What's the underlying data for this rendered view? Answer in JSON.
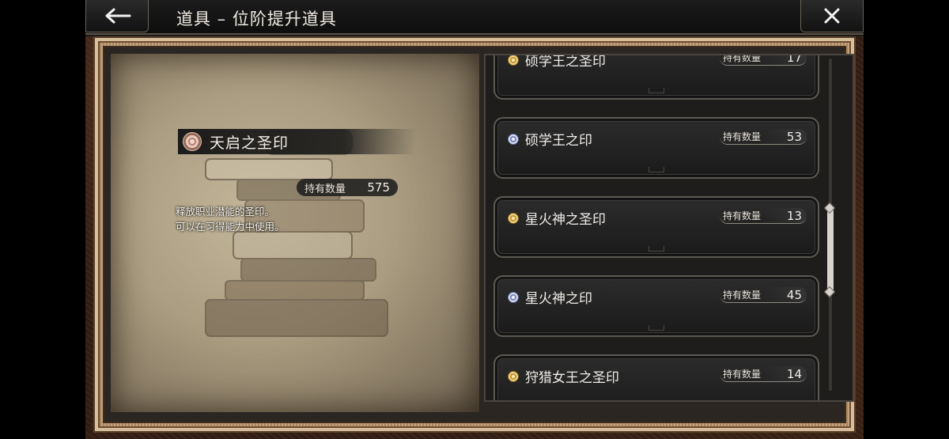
{
  "header": {
    "title": "道具 – 位阶提升道具"
  },
  "detail": {
    "name": "天启之圣印",
    "owned_label": "持有数量",
    "owned_value": "575",
    "description_line1": "释放职业潜能的圣印。",
    "description_line2": "可以在习得能力中使用。"
  },
  "list": {
    "items": [
      {
        "name": "硕学王之圣印",
        "qty_label": "持有数量",
        "qty": "17",
        "icon": "gold-seal-icon",
        "color": "#c49a3a"
      },
      {
        "name": "硕学王之印",
        "qty_label": "持有数量",
        "qty": "53",
        "icon": "silver-seal-icon",
        "color": "#7d8ab8"
      },
      {
        "name": "星火神之圣印",
        "qty_label": "持有数量",
        "qty": "13",
        "icon": "gold-seal-icon",
        "color": "#c49a3a"
      },
      {
        "name": "星火神之印",
        "qty_label": "持有数量",
        "qty": "45",
        "icon": "silver-seal-icon",
        "color": "#7d8ab8"
      },
      {
        "name": "狩猎女王之圣印",
        "qty_label": "持有数量",
        "qty": "14",
        "icon": "gold-seal-icon",
        "color": "#c49a3a"
      }
    ]
  }
}
